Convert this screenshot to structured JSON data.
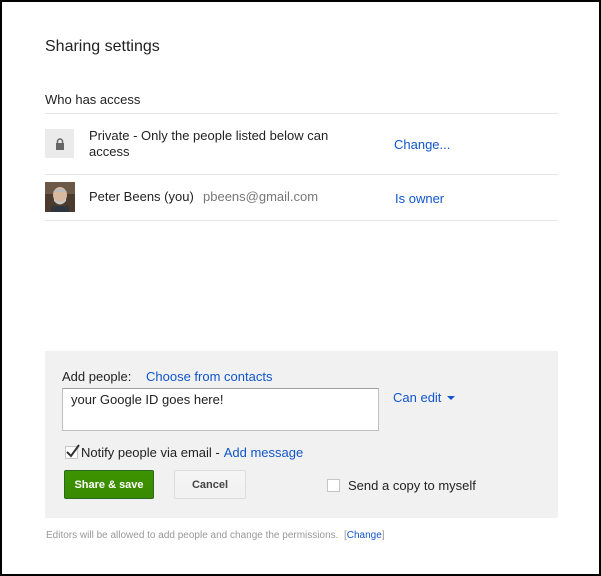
{
  "dialog": {
    "title": "Sharing settings",
    "section_heading": "Who has access"
  },
  "access": {
    "visibility_text": "Private - Only the people listed below can access",
    "change_link": "Change...",
    "lock_icon": "lock-icon"
  },
  "owner": {
    "name": "Peter Beens (you)",
    "email": "pbeens@gmail.com",
    "role_link": "Is owner"
  },
  "add_people": {
    "label": "Add people:",
    "choose_link": "Choose from contacts",
    "input_value": "your Google ID goes here!",
    "permission": "Can edit",
    "notify_checked": true,
    "notify_label": "Notify people via email -",
    "add_message_link": "Add message",
    "share_button": "Share & save",
    "cancel_button": "Cancel",
    "send_copy_checked": false,
    "send_copy_label": "Send a copy to myself"
  },
  "footer": {
    "text": "Editors will be allowed to add people and change the permissions.",
    "bracket_open": "[",
    "change_link": "Change",
    "bracket_close": "]"
  },
  "colors": {
    "link": "#1155cc",
    "share_button": "#3d9400",
    "panel_background": "#f1f1f1"
  }
}
